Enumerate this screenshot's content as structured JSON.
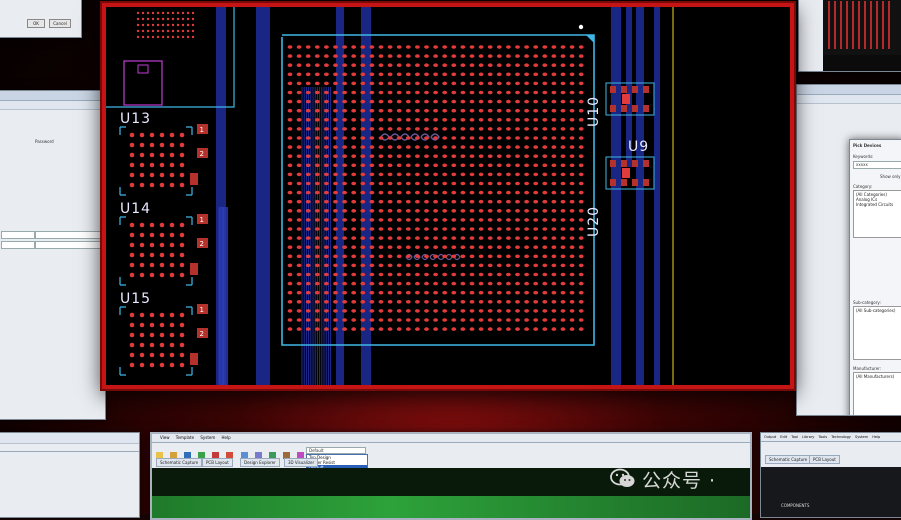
{
  "left_window": {
    "buttons": [
      "OK",
      "Cancel"
    ],
    "form_label": "Password"
  },
  "right_window": {
    "title": "Pick Devices",
    "keywords_label": "Keywords:",
    "keyword_value": "xxxxx",
    "category_label": "Category:",
    "categories": [
      "(All Categories)",
      "Analog ICs",
      "Integrated Circuits"
    ],
    "subcategory_label": "Sub-category:",
    "subcategories": [
      "(All Sub-categories)"
    ],
    "manufacturer_label": "Manufacturer:",
    "manufacturers": [
      "(All Manufacturers)"
    ],
    "show_label": "Show only"
  },
  "bottom_window": {
    "menu": [
      "View",
      "Template",
      "System",
      "Help"
    ],
    "tabs": [
      "Schematic Capture",
      "PCB Layout",
      "Design Explorer",
      "3D Visualizer"
    ],
    "layer_select": "Default",
    "layer_options": [
      "Default",
      "Top Design",
      "Solder Resist",
      "Default"
    ]
  },
  "bottom_right_window": {
    "menu": [
      "Output",
      "Edit",
      "Tool",
      "Library",
      "Tools",
      "Technology",
      "System",
      "Help"
    ],
    "tabs": [
      "Schematic Capture",
      "PCB Layout"
    ],
    "footer": "COMPONENTS"
  },
  "pcb": {
    "designators": [
      "U13",
      "U14",
      "U15",
      "U10",
      "U9",
      "U20"
    ],
    "colors": {
      "pad": "#e23b3b",
      "outline": "#3fb7e6",
      "silk": "#e8e8ff",
      "trace": "#1f2d9a",
      "copper": "#b5322c",
      "yellow": "#c9b020",
      "magenta": "#c03bd6"
    }
  },
  "watermark": {
    "text": "公众号 ·",
    "icon": "wechat-icon"
  }
}
